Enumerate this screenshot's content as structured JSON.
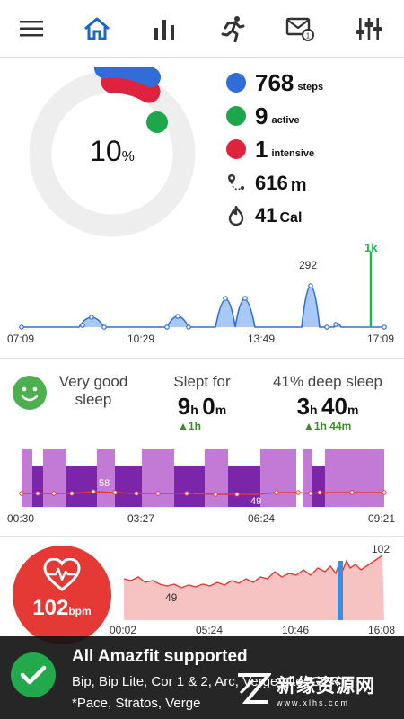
{
  "nav": {
    "items": [
      {
        "name": "menu-icon"
      },
      {
        "name": "home-icon",
        "active": true
      },
      {
        "name": "bar-chart-icon"
      },
      {
        "name": "running-icon"
      },
      {
        "name": "mail-badge-icon"
      },
      {
        "name": "equalizer-icon"
      }
    ],
    "accent": "#1e63c8"
  },
  "activity": {
    "goal_percent": "10",
    "goal_percent_sign": "%",
    "stats": [
      {
        "value": "768",
        "unit": "steps",
        "color": "#2f6ed8"
      },
      {
        "value": "9",
        "unit": "active",
        "color": "#1ea64d"
      },
      {
        "value": "1",
        "unit": "intensive",
        "color": "#e0233d"
      }
    ],
    "distance": {
      "value": "616",
      "unit": "m"
    },
    "calories": {
      "value": "41",
      "unit": "Cal"
    }
  },
  "steps_chart": {
    "x_labels": [
      "07:09",
      "10:29",
      "13:49",
      "17:09"
    ],
    "peak_label": "292",
    "goal_marker": "1k",
    "colors": {
      "line": "#2f6ed8",
      "fill": "#a9c8f5",
      "goal": "#18b84a"
    }
  },
  "sleep": {
    "quality_line1": "Very good",
    "quality_line2": "sleep",
    "slept_label": "Slept for",
    "slept_h": "9",
    "slept_m": "0",
    "slept_delta": "1h",
    "deep_label": "41% deep sleep",
    "deep_h": "3",
    "deep_m": "40",
    "deep_delta": "1h 44m",
    "unit_h": "h",
    "unit_m": "m",
    "x_labels": [
      "00:30",
      "03:27",
      "06:24",
      "09:21"
    ],
    "hr_labels": [
      "58",
      "49"
    ],
    "colors": {
      "light": "#c27ad6",
      "deep": "#7b25a8",
      "hr": "#e53935"
    }
  },
  "heart": {
    "value": "102",
    "unit": "bpm",
    "x_labels": [
      "00:02",
      "05:24",
      "10:46",
      "16:08"
    ],
    "min_label": "49",
    "max_label": "102",
    "colors": {
      "circle": "#e53935",
      "line": "#e53935",
      "fill": "#f7c3c2",
      "marker": "#3d8ce0"
    }
  },
  "banner": {
    "title": "All Amazfit supported",
    "line1": "Bip, Bip Lite, Cor 1 & 2, Arc, Verge Lite, GTR",
    "line2": "*Pace, Stratos, Verge",
    "watermark": "新缘资源网",
    "watermark_sub": "www.xlhs.com"
  }
}
